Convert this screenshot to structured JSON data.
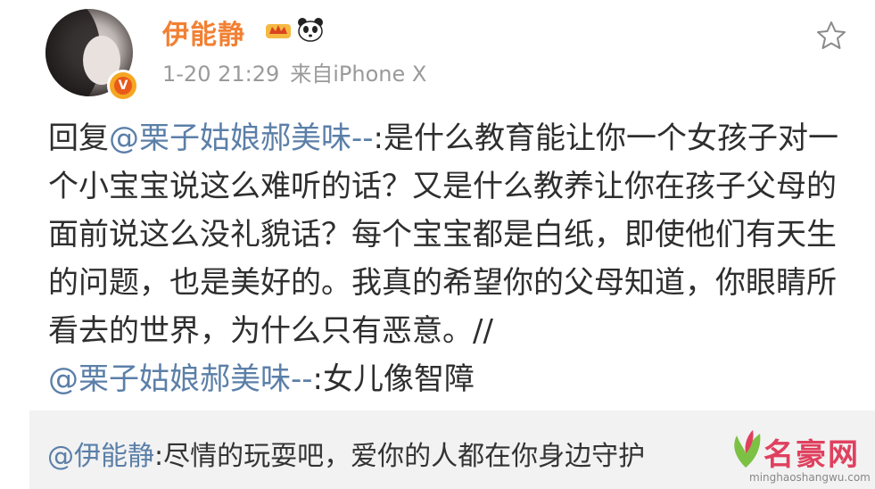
{
  "post": {
    "username": "伊能静",
    "timestamp": "1-20 21:29",
    "source": "来自iPhone X",
    "content": {
      "reply_prefix": "回复",
      "mention_1": "@栗子姑娘郝美味--",
      "body": ":是什么教育能让你一个女孩子对一个小宝宝说这么难听的话？又是什么教养让你在孩子父母的面前说这么没礼貌话？每个宝宝都是白纸，即使他们有天生的问题，也是美好的。我真的希望你的父母知道，你眼睛所看去的世界，为什么只有恶意。//",
      "mention_2": "@栗子姑娘郝美味--",
      "quoted": ":女儿像智障"
    }
  },
  "comment": {
    "mention": "@伊能静",
    "text": ":尽情的玩耍吧，爱你的人都在你身边守护"
  },
  "watermark": {
    "brand": "名豪网",
    "url": "minghaoshangwu.com"
  },
  "colors": {
    "username": "#f28033",
    "mention": "#5b7fa8",
    "verified_badge": "#f5a623",
    "comment_bg": "#f2f2f2"
  },
  "icons": [
    "verified-v-icon",
    "crown-icon",
    "panda-icon",
    "star-icon"
  ]
}
